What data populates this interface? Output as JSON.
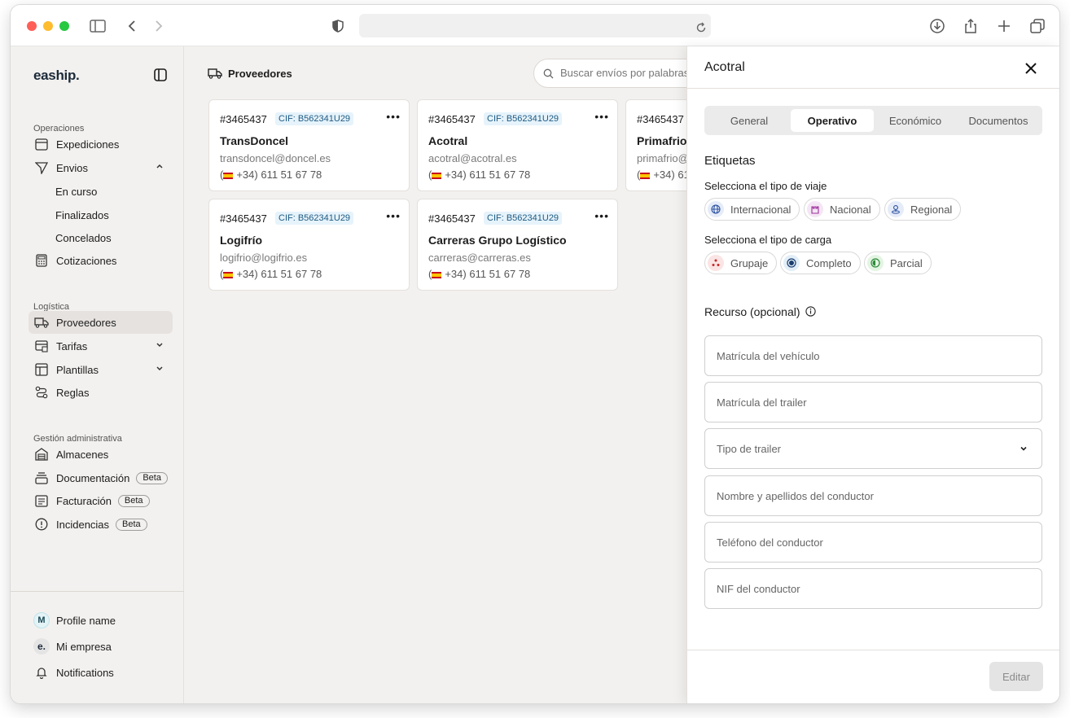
{
  "browser": {
    "url": ""
  },
  "sidebar": {
    "logo": "eaship.",
    "sections": {
      "operaciones": "Operaciones",
      "logistica": "Logística",
      "gestion": "Gestión administrativa"
    },
    "items": {
      "expediciones": "Expediciones",
      "envios": "Envios",
      "en_curso": "En curso",
      "finalizados": "Finalizados",
      "concelados": "Concelados",
      "cotizaciones": "Cotizaciones",
      "proveedores": "Proveedores",
      "tarifas": "Tarifas",
      "plantillas": "Plantillas",
      "reglas": "Reglas",
      "almacenes": "Almacenes",
      "documentacion": "Documentación",
      "facturacion": "Facturación",
      "incidencias": "Incidencias"
    },
    "beta": "Beta",
    "footer": {
      "profile": "Profile name",
      "profile_initial": "M",
      "company": "Mi empresa",
      "company_initial": "e.",
      "notifications": "Notifications"
    }
  },
  "main": {
    "title": "Proveedores",
    "search_placeholder": "Buscar envíos por palabras c",
    "cards": [
      {
        "num": "#3465437",
        "cif": "CIF: B562341U29",
        "name": "TransDoncel",
        "email": "transdoncel@doncel.es",
        "phone": "+34) 611 51 67 78"
      },
      {
        "num": "#3465437",
        "cif": "CIF: B562341U29",
        "name": "Acotral",
        "email": "acotral@acotral.es",
        "phone": "+34) 611 51 67 78"
      },
      {
        "num": "#3465437",
        "cif": "CIF: B562341U29",
        "name": "Primafrio",
        "email": "primafrio@",
        "phone": "+34) 61"
      },
      {
        "num": "#3465437",
        "cif": "CIF: B562341U29",
        "name": "Logifrío",
        "email": "logifrio@logifrio.es",
        "phone": "+34) 611 51 67 78"
      },
      {
        "num": "#3465437",
        "cif": "CIF: B562341U29",
        "name": "Carreras Grupo Logístico",
        "email": "carreras@carreras.es",
        "phone": "+34) 611 51 67 78"
      }
    ]
  },
  "panel": {
    "title": "Acotral",
    "tabs": [
      "General",
      "Operativo",
      "Económico",
      "Documentos"
    ],
    "active_tab": "Operativo",
    "etiquetas": "Etiquetas",
    "viaje_label": "Selecciona el tipo de viaje",
    "viaje": [
      "Internacional",
      "Nacional",
      "Regional"
    ],
    "carga_label": "Selecciona el tipo de carga",
    "carga": [
      "Grupaje",
      "Completo",
      "Parcial"
    ],
    "recurso": "Recurso (opcional)",
    "fields": [
      "Matrícula del vehículo",
      "Matrícula del trailer",
      "Tipo de trailer",
      "Nombre y apellidos del conductor",
      "Teléfono del conductor",
      "NIF del conductor"
    ],
    "edit_button": "Editar"
  }
}
